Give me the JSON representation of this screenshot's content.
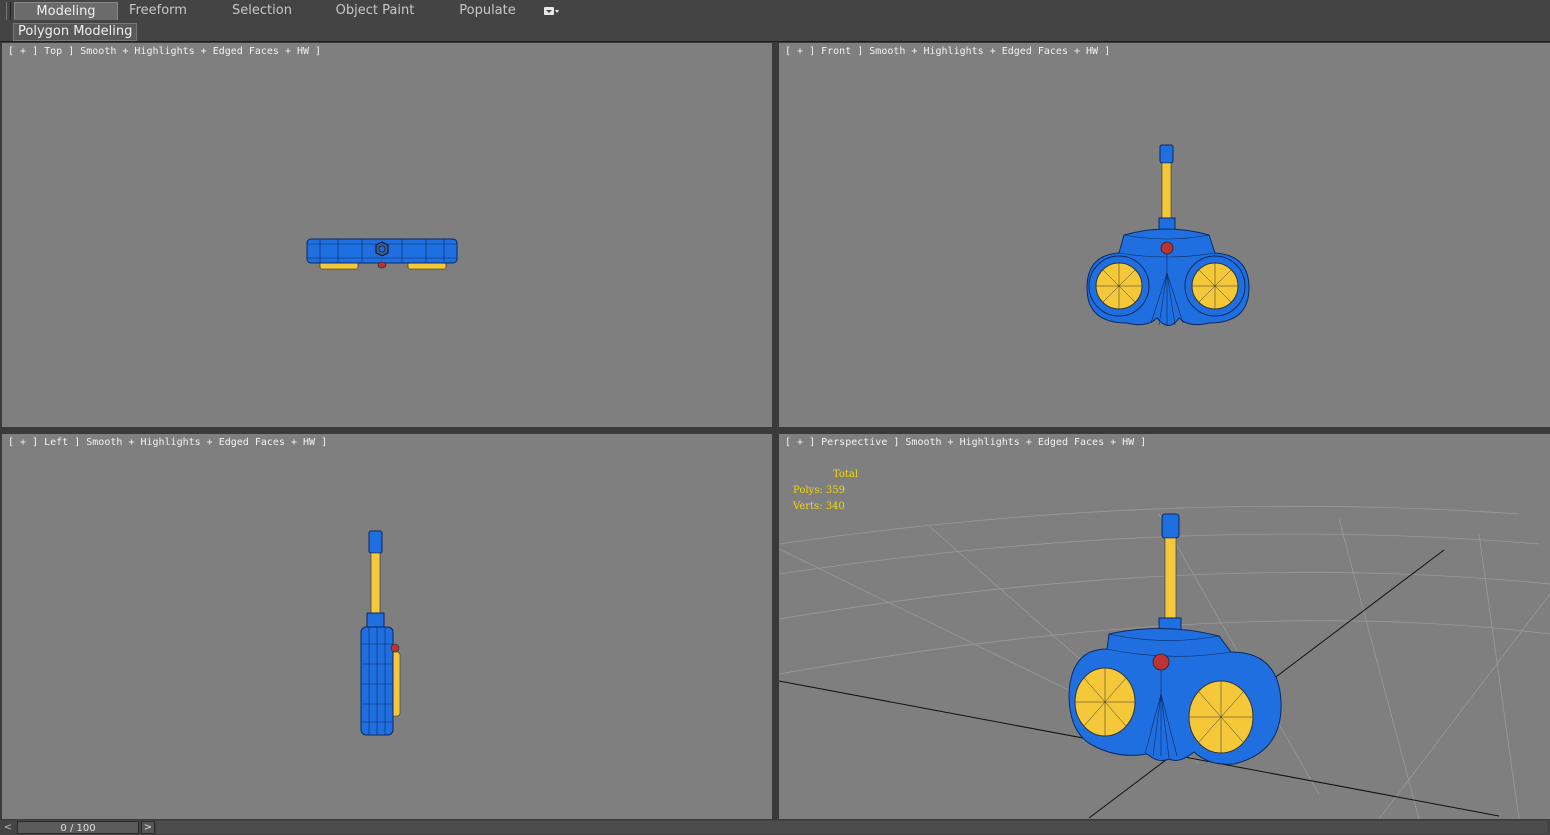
{
  "ribbon": {
    "tabs": [
      "Modeling",
      "Freeform",
      "Selection",
      "Object Paint",
      "Populate"
    ],
    "active_tab": "Modeling"
  },
  "panel_label": "Polygon Modeling",
  "viewports": {
    "top": "[ + ] Top ] Smooth + Highlights + Edged Faces + HW ]",
    "front": "[ + ] Front ] Smooth + Highlights + Edged Faces + HW ]",
    "left": "[ + ] Left ] Smooth + Highlights + Edged Faces + HW ]",
    "perspective": "[ + ] Perspective ] Smooth + Highlights + Edged Faces + HW ]"
  },
  "stats": {
    "header": "Total",
    "polys": "Polys: 359",
    "verts": "Verts: 340"
  },
  "timeline": {
    "prev": "<",
    "frame": "0 / 100",
    "next": ">"
  },
  "colors": {
    "viewport_bg": "#7f7f7f",
    "model_blue": "#1f6fe0",
    "model_yellow": "#f5c83a",
    "stat_yellow": "#f5d800"
  }
}
